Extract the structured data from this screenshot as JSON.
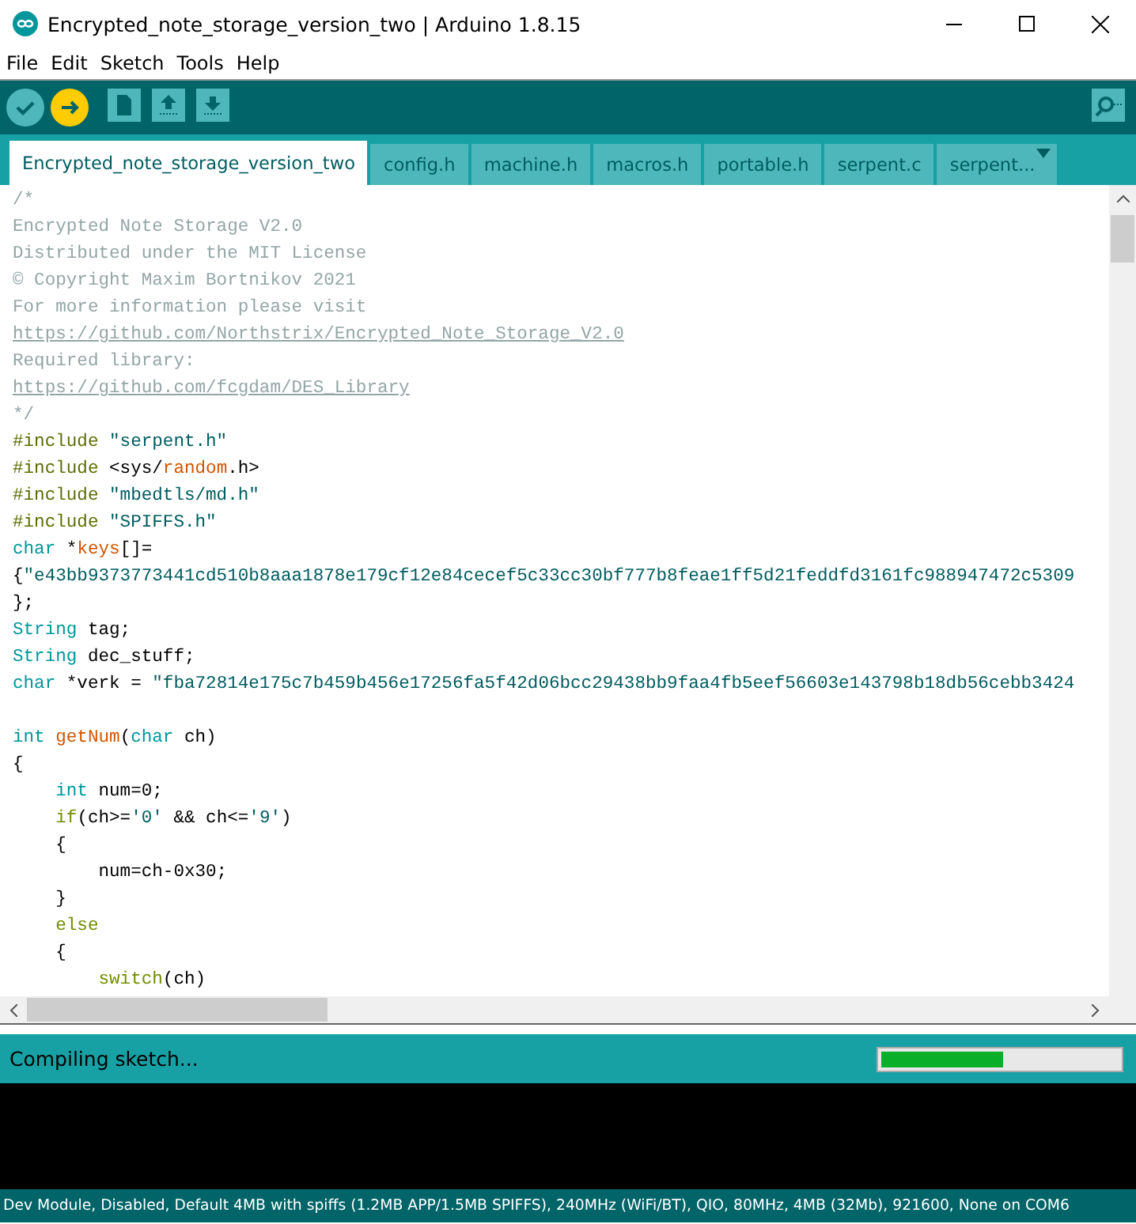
{
  "window": {
    "title": "Encrypted_note_storage_version_two | Arduino 1.8.15"
  },
  "menu": [
    "File",
    "Edit",
    "Sketch",
    "Tools",
    "Help"
  ],
  "tabs": [
    {
      "label": "Encrypted_note_storage_version_two",
      "selected": true
    },
    {
      "label": "config.h",
      "selected": false
    },
    {
      "label": "machine.h",
      "selected": false
    },
    {
      "label": "macros.h",
      "selected": false
    },
    {
      "label": "portable.h",
      "selected": false
    },
    {
      "label": "serpent.c",
      "selected": false
    },
    {
      "label": "serpent...",
      "selected": false
    }
  ],
  "editor": {
    "lines": [
      {
        "kind": "code",
        "tokens": [
          {
            "kind": "comment",
            "text": "/*"
          }
        ]
      },
      {
        "kind": "code",
        "tokens": [
          {
            "kind": "comment",
            "text": "Encrypted Note Storage V2.0"
          }
        ]
      },
      {
        "kind": "code",
        "tokens": [
          {
            "kind": "comment",
            "text": "Distributed under the MIT License"
          }
        ]
      },
      {
        "kind": "code",
        "tokens": [
          {
            "kind": "comment",
            "text": "© Copyright Maxim Bortnikov 2021"
          }
        ]
      },
      {
        "kind": "code",
        "tokens": [
          {
            "kind": "comment",
            "text": "For more information please visit"
          }
        ]
      },
      {
        "kind": "link",
        "text": "https://github.com/Northstrix/Encrypted_Note_Storage_V2.0"
      },
      {
        "kind": "code",
        "tokens": [
          {
            "kind": "comment",
            "text": "Required library:"
          }
        ]
      },
      {
        "kind": "link",
        "text": "https://github.com/fcgdam/DES_Library"
      },
      {
        "kind": "code",
        "tokens": [
          {
            "kind": "comment",
            "text": "*/"
          }
        ]
      },
      {
        "kind": "code",
        "tokens": [
          {
            "kind": "preproc",
            "text": "#include"
          },
          {
            "kind": "string",
            "text": " \"serpent.h\""
          }
        ]
      },
      {
        "kind": "code",
        "tokens": [
          {
            "kind": "preproc",
            "text": "#include"
          },
          {
            "kind": "plain",
            "text": " <sys/"
          },
          {
            "kind": "func",
            "text": "random"
          },
          {
            "kind": "plain",
            "text": ".h>"
          }
        ]
      },
      {
        "kind": "code",
        "tokens": [
          {
            "kind": "preproc",
            "text": "#include"
          },
          {
            "kind": "string",
            "text": " \"mbedtls/md.h\""
          }
        ]
      },
      {
        "kind": "code",
        "tokens": [
          {
            "kind": "preproc",
            "text": "#include"
          },
          {
            "kind": "string",
            "text": " \"SPIFFS.h\""
          }
        ]
      },
      {
        "kind": "code",
        "tokens": [
          {
            "kind": "type",
            "text": "char"
          },
          {
            "kind": "plain",
            "text": " *"
          },
          {
            "kind": "func",
            "text": "keys"
          },
          {
            "kind": "plain",
            "text": "[]="
          }
        ]
      },
      {
        "kind": "code",
        "tokens": [
          {
            "kind": "plain",
            "text": "{"
          },
          {
            "kind": "string",
            "text": "\"e43bb9373773441cd510b8aaa1878e179cf12e84cecef5c33cc30bf777b8feae1ff5d21feddfd3161fc988947472c5309"
          }
        ]
      },
      {
        "kind": "code",
        "tokens": [
          {
            "kind": "plain",
            "text": "};"
          }
        ]
      },
      {
        "kind": "code",
        "tokens": [
          {
            "kind": "type",
            "text": "String"
          },
          {
            "kind": "plain",
            "text": " tag;"
          }
        ]
      },
      {
        "kind": "code",
        "tokens": [
          {
            "kind": "type",
            "text": "String"
          },
          {
            "kind": "plain",
            "text": " dec_stuff;"
          }
        ]
      },
      {
        "kind": "code",
        "tokens": [
          {
            "kind": "type",
            "text": "char"
          },
          {
            "kind": "plain",
            "text": " *verk = "
          },
          {
            "kind": "string",
            "text": "\"fba72814e175c7b459b456e17256fa5f42d06bcc29438bb9faa4fb5eef56603e143798b18db56cebb3424"
          }
        ]
      },
      {
        "kind": "blank"
      },
      {
        "kind": "code",
        "tokens": [
          {
            "kind": "type",
            "text": "int"
          },
          {
            "kind": "func",
            "text": " getNum"
          },
          {
            "kind": "plain",
            "text": "("
          },
          {
            "kind": "type",
            "text": "char"
          },
          {
            "kind": "plain",
            "text": " ch)"
          }
        ]
      },
      {
        "kind": "code",
        "tokens": [
          {
            "kind": "plain",
            "text": "{"
          }
        ]
      },
      {
        "kind": "code",
        "tokens": [
          {
            "kind": "type",
            "text": "    int"
          },
          {
            "kind": "plain",
            "text": " num=0;"
          }
        ]
      },
      {
        "kind": "code",
        "tokens": [
          {
            "kind": "control",
            "text": "    if"
          },
          {
            "kind": "plain",
            "text": "(ch>="
          },
          {
            "kind": "string",
            "text": "'0'"
          },
          {
            "kind": "plain",
            "text": " && ch<="
          },
          {
            "kind": "string",
            "text": "'9'"
          },
          {
            "kind": "plain",
            "text": ")"
          }
        ]
      },
      {
        "kind": "code",
        "tokens": [
          {
            "kind": "plain",
            "text": "    {"
          }
        ]
      },
      {
        "kind": "code",
        "tokens": [
          {
            "kind": "plain",
            "text": "        num=ch-0x30;"
          }
        ]
      },
      {
        "kind": "code",
        "tokens": [
          {
            "kind": "plain",
            "text": "    }"
          }
        ]
      },
      {
        "kind": "code",
        "tokens": [
          {
            "kind": "control",
            "text": "    else"
          }
        ]
      },
      {
        "kind": "code",
        "tokens": [
          {
            "kind": "plain",
            "text": "    {"
          }
        ]
      },
      {
        "kind": "code",
        "tokens": [
          {
            "kind": "control",
            "text": "        switch"
          },
          {
            "kind": "plain",
            "text": "(ch)"
          }
        ]
      }
    ]
  },
  "status": {
    "message": "Compiling sketch...",
    "level": 0.51
  },
  "footer": "Dev Module, Disabled, Default 4MB with spiffs (1.2MB APP/1.5MB SPIFFS), 240MHz (WiFi/BT), QIO, 80MHz, 4MB (32Mb), 921600, None on COM6"
}
